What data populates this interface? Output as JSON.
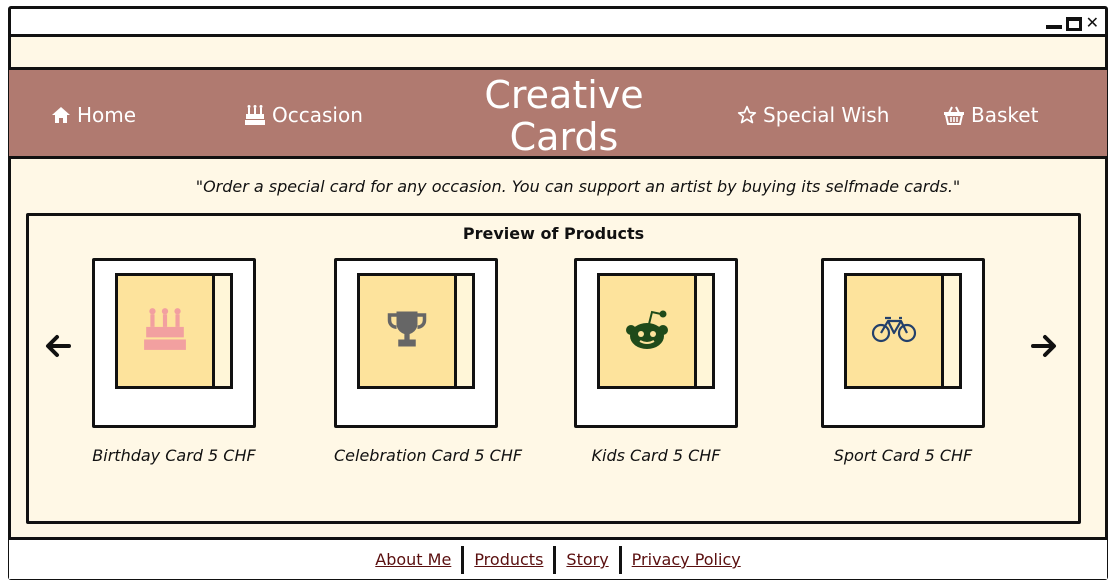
{
  "window": {
    "controls": {
      "minimize": "minimize-icon",
      "maximize": "maximize-icon",
      "close": "✕"
    }
  },
  "nav": {
    "home": {
      "label": "Home",
      "icon": "home-icon"
    },
    "occasion": {
      "label": "Occasion",
      "icon": "birthday-cake-icon"
    },
    "brand_line1": "Creative",
    "brand_line2": "Cards",
    "special_wish": {
      "label": "Special Wish",
      "icon": "star-outline-icon"
    },
    "basket": {
      "label": "Basket",
      "icon": "basket-icon"
    }
  },
  "tagline": "\"Order a special card for any occasion. You can support an artist by buying its selfmade cards.\"",
  "preview": {
    "title": "Preview of Products",
    "prev": "arrow-left-icon",
    "next": "arrow-right-icon",
    "products": [
      {
        "label": "Birthday Card 5 CHF",
        "icon": "birthday-cake-icon",
        "icon_color": "#f2a0a0"
      },
      {
        "label": "Celebration Card 5 CHF",
        "icon": "trophy-icon",
        "icon_color": "#666666"
      },
      {
        "label": "Kids Card 5 CHF",
        "icon": "reddit-alien-icon",
        "icon_color": "#1f4a1a"
      },
      {
        "label": "Sport Card 5 CHF",
        "icon": "bicycle-icon",
        "icon_color": "#23406b"
      }
    ]
  },
  "footer": {
    "links": [
      "About Me",
      "Products",
      "Story",
      "Privacy Policy"
    ]
  },
  "colors": {
    "nav_bg": "#b07a70",
    "page_bg": "#fff8e6",
    "card_bg": "#fde39c",
    "footer_link": "#5a0f0f"
  }
}
